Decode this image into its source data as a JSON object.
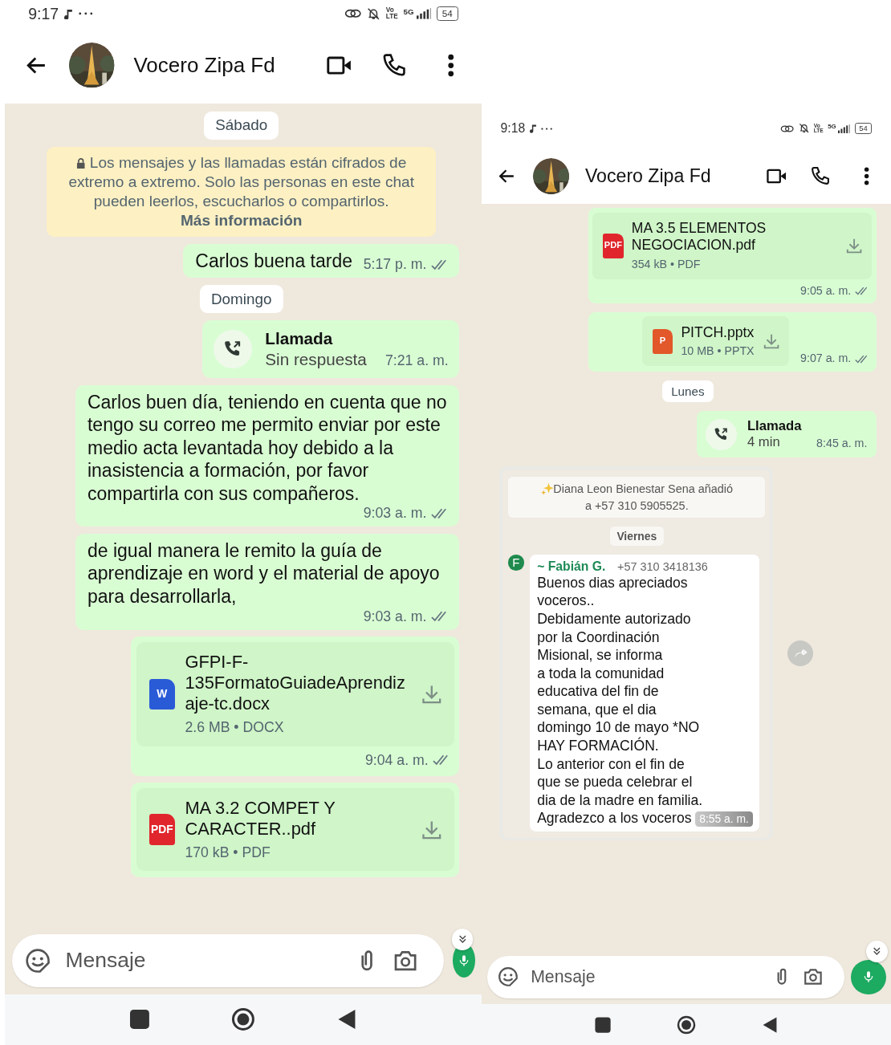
{
  "screens": [
    {
      "status_bar": {
        "time": "9:17",
        "volte": [
          "Vo",
          "LTE"
        ],
        "network_type": "5G",
        "battery": "54"
      },
      "header": {
        "contact_name": "Vocero Zipa Fd"
      },
      "messages": [
        {
          "kind": "date",
          "text": "Sábado"
        },
        {
          "kind": "notice",
          "text": "Los mensajes y las llamadas están cifrados de extremo a extremo. Solo las personas en este chat pueden leerlos, escucharlos o compartirlos.",
          "link": "Más información"
        },
        {
          "kind": "text",
          "text": "Carlos buena tarde",
          "time": "5:17 p. m."
        },
        {
          "kind": "date",
          "text": "Domingo"
        },
        {
          "kind": "call",
          "title": "Llamada",
          "detail": "Sin respuesta",
          "time": "7:21 a. m."
        },
        {
          "kind": "text",
          "text": "Carlos buen día, teniendo en cuenta que no tengo su correo me permito enviar por este medio acta levantada hoy debido a la inasistencia a formación, por favor compartirla con sus compañeros.",
          "time": "9:03 a. m."
        },
        {
          "kind": "text",
          "text": "de igual manera le remito la guía de aprendizaje en word y el material de apoyo para desarrollarla,",
          "time": "9:03 a. m."
        },
        {
          "kind": "document",
          "color": "#2a5bd7",
          "icon_label": "W",
          "name": "GFPI-F-135FormatoGuiadeAprendizaje-tc.docx",
          "meta": "2.6 MB • DOCX",
          "time": "9:04 a. m."
        },
        {
          "kind": "document",
          "color": "#e0262c",
          "icon_label": "PDF",
          "name": "MA 3.2 COMPET Y CARACTER..pdf",
          "meta": "170 kB • PDF"
        }
      ],
      "composer": {
        "placeholder": "Mensaje"
      }
    },
    {
      "status_bar": {
        "time": "9:18",
        "volte": [
          "Vo",
          "LTE"
        ],
        "network_type": "5G",
        "battery": "54"
      },
      "header": {
        "contact_name": "Vocero Zipa Fd"
      },
      "messages": [
        {
          "kind": "document",
          "color": "#e0262c",
          "icon_label": "PDF",
          "name": "MA 3.5 ELEMENTOS NEGOCIACION.pdf",
          "meta": "354 kB • PDF",
          "time": "9:05 a. m."
        },
        {
          "kind": "document",
          "color": "#e2582a",
          "icon_label": "P",
          "name": "PITCH.pptx",
          "meta": "10 MB • PPTX",
          "time": "9:07 a. m."
        },
        {
          "kind": "date",
          "text": "Lunes"
        },
        {
          "kind": "call",
          "title": "Llamada",
          "detail": "4 min",
          "time": "8:45 a. m."
        },
        {
          "kind": "screenshot",
          "items": [
            {
              "kind": "system",
              "text": "Diana Leon Bienestar Sena añadió a +57 310 5905525."
            },
            {
              "kind": "date",
              "text": "Viernes"
            },
            {
              "kind": "group_text",
              "initial": "F",
              "sender": "~ Fabián G.",
              "phone": "+57 310 3418136",
              "text": "Buenos dias apreciados\nvoceros..\nDebidamente autorizado\npor la Coordinación\nMisional, se informa\na toda la comunidad\neducativa del fin de\nsemana,  que el dia\ndomingo 10 de mayo *NO\nHAY FORMACIÓN.\nLo anterior con el fin de\nque se pueda celebrar el\ndia de la madre en familia.\nAgradezco a los voceros",
              "time": "8:55 a. m."
            }
          ]
        }
      ],
      "composer": {
        "placeholder": "Mensaje"
      }
    }
  ]
}
